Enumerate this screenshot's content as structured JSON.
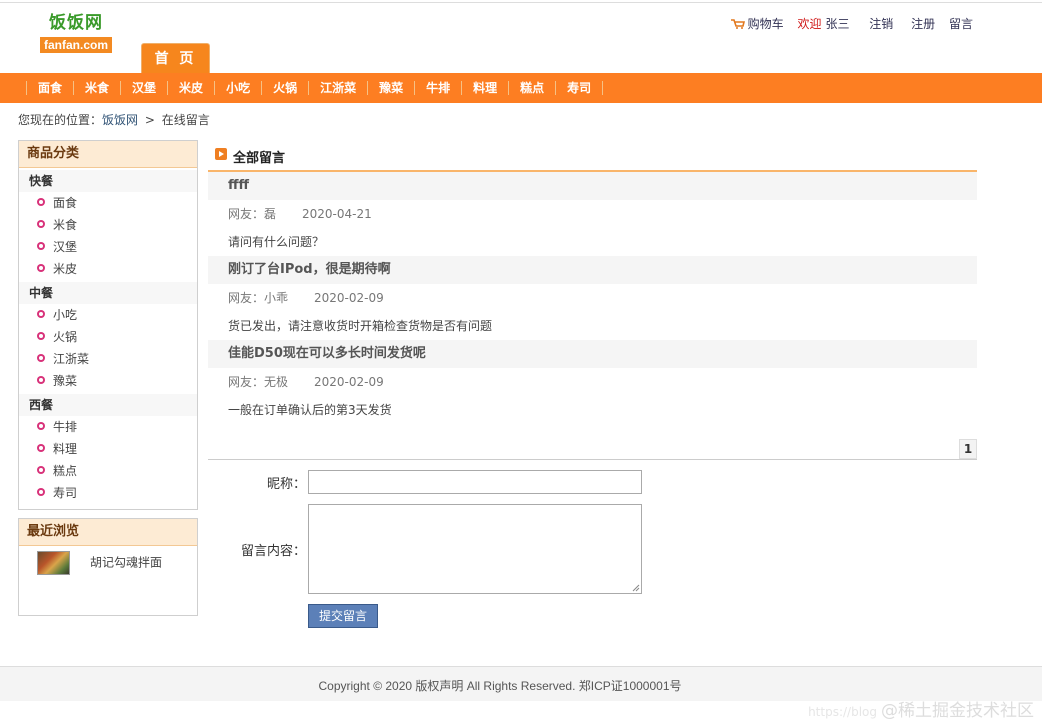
{
  "logo": {
    "cn": "饭饭网",
    "en": "fanfan.com"
  },
  "toplinks": {
    "cart": "购物车",
    "welcome": "欢迎",
    "user": "张三",
    "logout": "注销",
    "register": "注册",
    "message": "留言"
  },
  "home_tab": "首 页",
  "nav": [
    "面食",
    "米食",
    "汉堡",
    "米皮",
    "小吃",
    "火锅",
    "江浙菜",
    "豫菜",
    "牛排",
    "料理",
    "糕点",
    "寿司"
  ],
  "breadcrumb": {
    "prefix": "您现在的位置：",
    "site": "饭饭网",
    "sep": ">",
    "current": "在线留言"
  },
  "categories": {
    "title": "商品分类",
    "groups": [
      {
        "name": "快餐",
        "items": [
          "面食",
          "米食",
          "汉堡",
          "米皮"
        ]
      },
      {
        "name": "中餐",
        "items": [
          "小吃",
          "火锅",
          "江浙菜",
          "豫菜"
        ]
      },
      {
        "name": "西餐",
        "items": [
          "牛排",
          "料理",
          "糕点",
          "寿司"
        ]
      }
    ]
  },
  "recent": {
    "title": "最近浏览",
    "item": "胡记勾魂拌面"
  },
  "main": {
    "title": "全部留言",
    "messages": [
      {
        "title": "ffff",
        "author": "网友：磊",
        "date": "2020-04-21",
        "body": "请问有什么问题？"
      },
      {
        "title": "刚订了台IPod，很是期待啊",
        "author": "网友：小乖",
        "date": "2020-02-09",
        "body": "货已发出，请注意收货时开箱检查货物是否有问题"
      },
      {
        "title": "佳能D50现在可以多长时间发货呢",
        "author": "网友：无极",
        "date": "2020-02-09",
        "body": "一般在订单确认后的第3天发货"
      }
    ],
    "page": "1"
  },
  "form": {
    "nickname_label": "昵称：",
    "content_label": "留言内容：",
    "submit": "提交留言"
  },
  "footer": {
    "copyright": "Copyright © 2020 版权声明 All Rights Reserved. 郑ICP证1000001号"
  },
  "watermark": {
    "small": "https://blog",
    "big": "@稀土掘金技术社区"
  },
  "colors": {
    "nav": "#fd7e22",
    "brand_green": "#3a9a2a",
    "accent_red": "#d01818",
    "bullet": "#d8327a"
  }
}
